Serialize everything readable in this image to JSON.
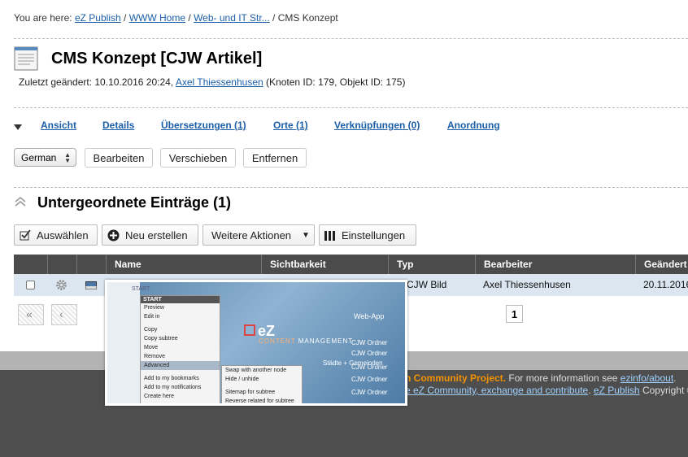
{
  "breadcrumb": {
    "prefix": "You are here:",
    "items": [
      "eZ Publish",
      "WWW Home",
      "Web- und IT Str..."
    ],
    "current": "CMS Konzept",
    "sep": "/"
  },
  "page": {
    "title": "CMS Konzept [CJW Artikel]",
    "meta_prefix": "Zuletzt geändert: 10.10.2016 20:24,",
    "author": "Axel Thiessenhusen",
    "meta_suffix": "(Knoten ID: 179, Objekt ID: 175)"
  },
  "tabs": [
    "Ansicht",
    "Details",
    "Übersetzungen (1)",
    "Orte (1)",
    "Verknüpfungen (0)",
    "Anordnung"
  ],
  "actions": {
    "language": "German",
    "edit": "Bearbeiten",
    "move": "Verschieben",
    "remove": "Entfernen"
  },
  "children": {
    "title": "Untergeordnete Einträge (1)",
    "select": "Auswählen",
    "create": "Neu erstellen",
    "more": "Weitere Aktionen",
    "settings": "Einstellungen"
  },
  "table": {
    "headers": [
      "Name",
      "Sichtbarkeit",
      "Typ",
      "Bearbeiter",
      "Geändert"
    ],
    "row": {
      "type": "CJW Bild",
      "editor": "Axel Thiessenhusen",
      "modified": "20.11.2016"
    },
    "page": "1"
  },
  "preview": {
    "menu_header": "START",
    "menu_items": [
      "Preview",
      "Edit in",
      "Copy",
      "Copy subtree",
      "Move",
      "Remove",
      "Advanced",
      "Add to my bookmarks",
      "Add to my notifications",
      "Create here"
    ],
    "submenu": [
      "Swap with another node",
      "Hide / unhide",
      "Sitemap for subtree",
      "Reverse related for subtree"
    ],
    "logo": "eZ",
    "tagline_a": "CONTENT",
    "tagline_b": "MANAGEMENT",
    "labels": [
      "Web-App",
      "CJW Ordner",
      "Städte + Gemeinden",
      "CJW Ordner",
      "CJW Ordner",
      "CJW Ordner",
      "CJW Ordner"
    ],
    "side_label": "START"
  },
  "footer": {
    "line1_orange": "h Community Project.",
    "line1_text": "For more information see",
    "line1_link": "ezinfo/about",
    "line2_link1": "e eZ Community, exchange and contribute",
    "line2_link2": "eZ Publish",
    "line2_text": "Copyright ©"
  }
}
